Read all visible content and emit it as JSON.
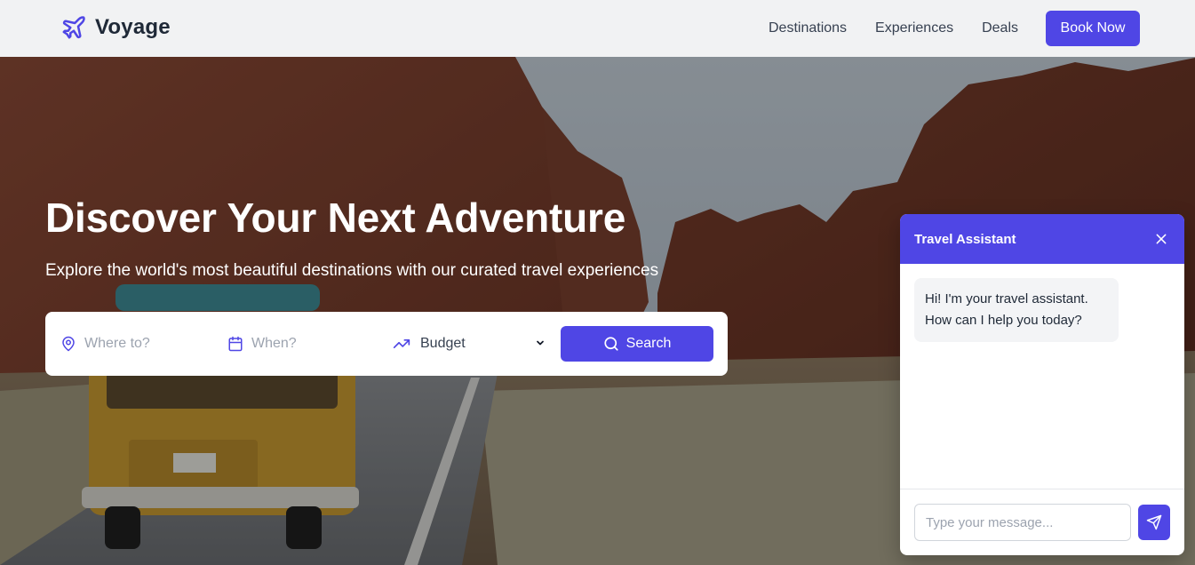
{
  "colors": {
    "brand": "#4f46e5",
    "header_bg": "#f3f3f4",
    "text_dark": "#1f2937",
    "placeholder": "#9ca3af"
  },
  "header": {
    "logo_icon": "plane-icon",
    "logo_text": "Voyage",
    "nav": [
      "Destinations",
      "Experiences",
      "Deals"
    ],
    "cta_label": "Book Now"
  },
  "hero": {
    "background": "desert-road-van-photo",
    "title": "Discover Your Next Adventure",
    "subtitle": "Explore the world's most beautiful destinations with our curated travel experiences"
  },
  "search": {
    "where": {
      "icon": "map-pin-icon",
      "placeholder": "Where to?",
      "value": ""
    },
    "when": {
      "icon": "calendar-icon",
      "placeholder": "When?",
      "value": ""
    },
    "budget": {
      "icon": "trending-up-icon",
      "selected": "Budget",
      "caret": "chevron-down-icon"
    },
    "button_icon": "search-icon",
    "button_label": "Search"
  },
  "chat": {
    "title": "Travel Assistant",
    "close_icon": "close-icon",
    "messages": [
      {
        "from": "assistant",
        "text": "Hi! I'm your travel assistant. How can I help you today?"
      }
    ],
    "input_placeholder": "Type your message...",
    "send_icon": "send-icon"
  }
}
